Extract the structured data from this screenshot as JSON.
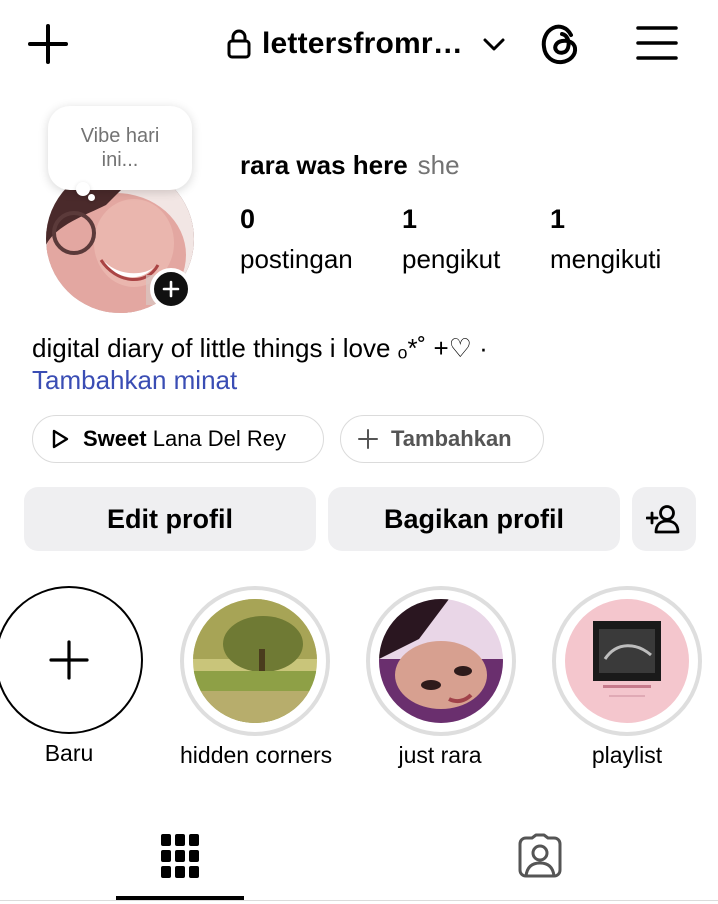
{
  "header": {
    "username": "lettersfromr…",
    "icons": {
      "add": "plus-icon",
      "lock": "lock-icon",
      "dropdown": "chevron-down-icon",
      "threads": "threads-icon",
      "menu": "hamburger-menu-icon"
    }
  },
  "profile": {
    "note": "Vibe hari ini...",
    "display_name": "rara was here",
    "pronouns": "she",
    "stats": [
      {
        "value": "0",
        "label": "postingan"
      },
      {
        "value": "1",
        "label": "pengikut"
      },
      {
        "value": "1",
        "label": "mengikuti"
      }
    ],
    "bio": "digital diary of little things i love ₒ*˚ +♡ ·",
    "add_interest": "Tambahkan minat"
  },
  "music_pill": {
    "song": "Sweet",
    "artist": "Lana Del Rey",
    "icon": "play-icon"
  },
  "add_pill": {
    "label": "Tambahkan",
    "icon": "plus-icon"
  },
  "buttons": {
    "edit": "Edit profil",
    "share": "Bagikan profil",
    "suggest_icon": "add-person-icon"
  },
  "highlights": [
    {
      "label": "Baru",
      "kind": "new"
    },
    {
      "label": "hidden corners",
      "kind": "image"
    },
    {
      "label": "just rara",
      "kind": "image"
    },
    {
      "label": "playlist",
      "kind": "image"
    }
  ],
  "tabs": [
    {
      "icon": "grid-icon",
      "active": true
    },
    {
      "icon": "tagged-icon",
      "active": false
    }
  ],
  "colors": {
    "link": "#3a4db4",
    "button_bg": "#efeff1",
    "muted_text": "#737373"
  }
}
